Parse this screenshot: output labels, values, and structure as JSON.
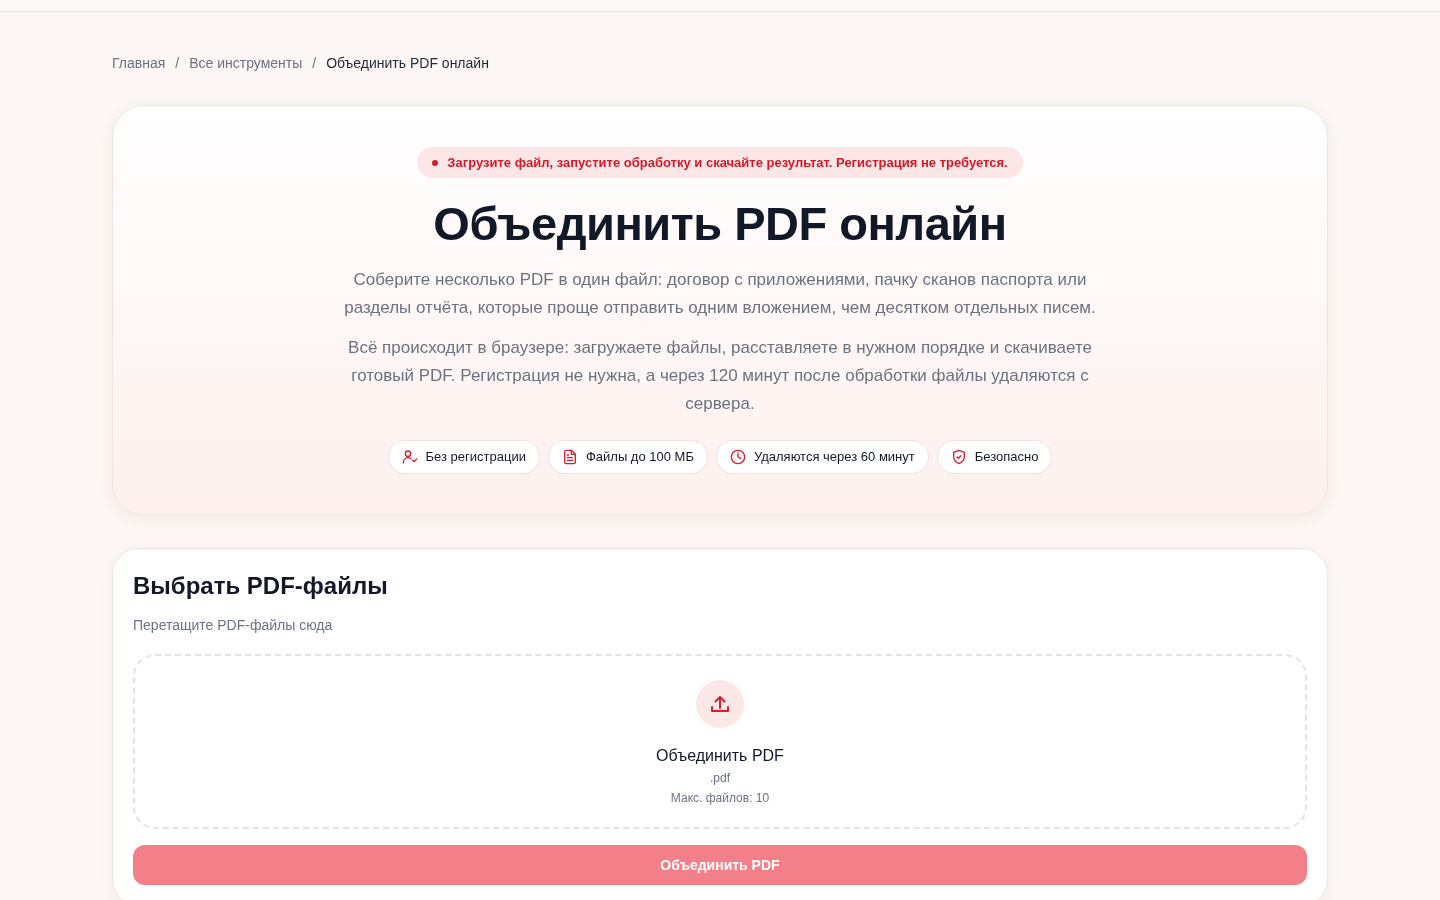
{
  "breadcrumb": [
    {
      "label": "Главная",
      "current": false
    },
    {
      "separator": "/",
      "label": "Все инструменты",
      "current": false
    },
    {
      "separator": "/",
      "label": "Объединить PDF онлайн",
      "current": true
    }
  ],
  "hero": {
    "notice": "Загрузите файл, запустите обработку и скачайте результат. Регистрация не требуется.",
    "title": "Объединить PDF онлайн",
    "paragraphs": [
      "Соберите несколько PDF в один файл: договор с приложениями, пачку сканов паспорта или разделы отчёта, которые проще отправить одним вложением, чем десятком отдельных писем.",
      "Всё происходит в браузере: загружаете файлы, расставляете в нужном порядке и скачиваете готовый PDF. Регистрация не нужна, а через 120 минут после обработки файлы удаляются с сервера."
    ],
    "features": [
      {
        "kind": "user",
        "label": "Без регистрации"
      },
      {
        "kind": "file",
        "label": "Файлы до 100 МБ"
      },
      {
        "kind": "clock",
        "label": "Удаляются через 60 минут"
      },
      {
        "kind": "shield",
        "label": "Безопасно"
      }
    ]
  },
  "upload": {
    "title": "Выбрать PDF-файлы",
    "hint": "Перетащите PDF-файлы сюда",
    "dropzone": {
      "title": "Объединить PDF",
      "accept": ".pdf",
      "limit": "Макс. файлов: 10"
    },
    "submit": {
      "label": "Объединить PDF",
      "disabled": true
    }
  }
}
